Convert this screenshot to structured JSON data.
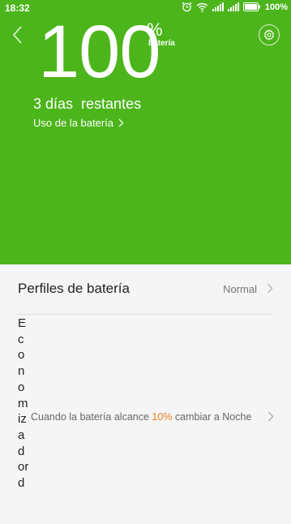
{
  "status_bar": {
    "time": "18:32",
    "battery_percent": "100%",
    "icons": [
      "alarm-icon",
      "wifi-icon",
      "signal-icon",
      "signal-icon",
      "battery-icon"
    ]
  },
  "hero": {
    "background_color": "#4cb51b",
    "level": "100",
    "percent_sign": "%",
    "level_label": "batería",
    "remaining_text": "3 días  restantes",
    "usage_link": "Uso de la batería"
  },
  "profiles": {
    "label": "Perfiles de batería",
    "value": "Normal"
  },
  "saver": {
    "title": "Economizador d",
    "text_before": "Cuando la batería alcance ",
    "threshold": "10%",
    "text_after": " cambiar a Noche",
    "highlight_color": "#ef7d1c"
  }
}
